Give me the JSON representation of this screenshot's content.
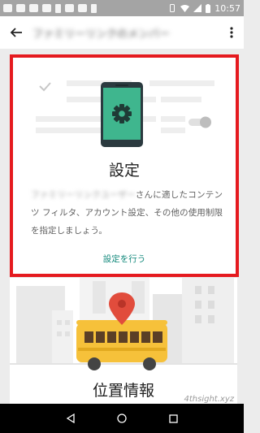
{
  "status_bar": {
    "time": "10:57"
  },
  "app_bar": {
    "title": "ファミリーリンクのメンバー"
  },
  "card": {
    "title": "設定",
    "body_name": "ファミリーリンクユーザー",
    "body_text": "さんに適したコンテンツ フィルタ、アカウント設定、その他の使用制限を指定しましょう。",
    "link": "設定を行う"
  },
  "card2": {
    "title": "位置情報"
  },
  "watermark": "4thsight.xyz",
  "colors": {
    "highlight": "#e51a1f",
    "accent": "#13897c",
    "phone": "#3fb68e"
  }
}
